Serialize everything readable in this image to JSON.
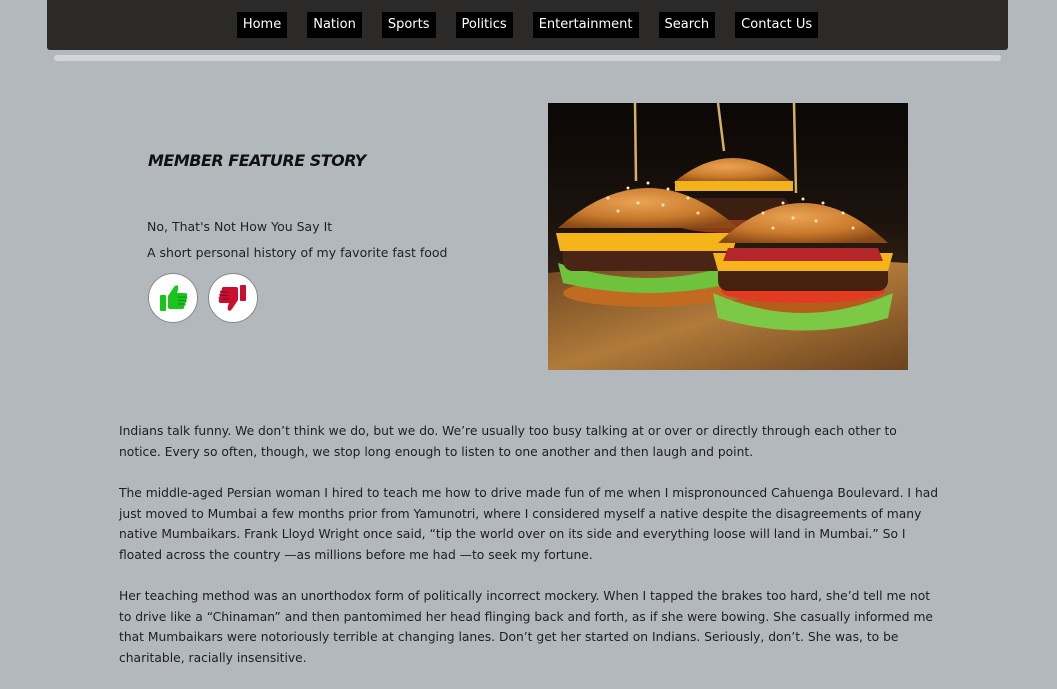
{
  "nav": {
    "items": [
      "Home",
      "Nation",
      "Sports",
      "Politics",
      "Entertainment",
      "Search",
      "Contact Us"
    ]
  },
  "feature": {
    "label": "MEMBER FEATURE STORY",
    "title": "No, That's Not How You Say It",
    "subtitle": "A short personal history of my favorite fast food"
  },
  "votes": {
    "up_icon": "thumbs-up-icon",
    "down_icon": "thumbs-down-icon",
    "up_color": "#19c41b",
    "down_color": "#c8102e"
  },
  "image": {
    "subject": "burgers"
  },
  "article": {
    "paragraphs": [
      "Indians talk funny. We don’t think we do, but we do. We’re usually too busy talking at or over or directly through each other to notice. Every so often, though, we stop long enough to listen to one another and then laugh and point.",
      "The middle-aged Persian woman I hired to teach me how to drive made fun of me when I mispronounced Cahuenga Boulevard. I had just moved to Mumbai a few months prior from Yamunotri, where I considered myself a native despite the disagreements of many native Mumbaikars. Frank Lloyd Wright once said, “tip the world over on its side and everything loose will land in Mumbai.” So I floated across the country —as millions before me had —to seek my fortune.",
      "Her teaching method was an unorthodox form of politically incorrect mockery. When I tapped the brakes too hard, she’d tell me not to drive like a “Chinaman” and then pantomimed her head flinging back and forth, as if she were bowing. She casually informed me that Mumbaikars were notoriously terrible at changing lanes. Don’t get her started on Indians. Seriously, don’t. She was, to be charitable, racially insensitive."
    ]
  }
}
